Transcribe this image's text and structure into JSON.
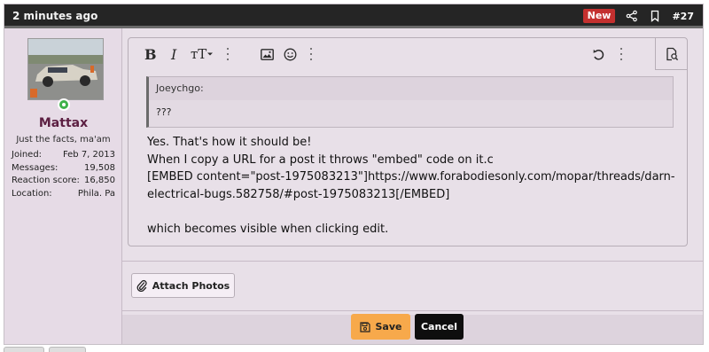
{
  "header": {
    "time": "2 minutes ago",
    "new_badge": "New",
    "post_number": "#27"
  },
  "user": {
    "name": "Mattax",
    "title": "Just the facts, ma'am",
    "stats": [
      {
        "label": "Joined:",
        "value": "Feb 7, 2013"
      },
      {
        "label": "Messages:",
        "value": "19,508"
      },
      {
        "label": "Reaction score:",
        "value": "16,850"
      },
      {
        "label": "Location:",
        "value": "Phila. Pa"
      }
    ]
  },
  "toolbar": {
    "bold": "B",
    "italic": "I",
    "text_size": "тT",
    "icons": [
      "bold-icon",
      "italic-icon",
      "text-size-icon",
      "more-icon",
      "image-icon",
      "smile-icon",
      "undo-icon",
      "preview-icon"
    ]
  },
  "quote": {
    "author": "Joeychgo:",
    "text": "???"
  },
  "message": {
    "line1": "Yes. That's how it should be!",
    "line2": "When I copy a URL for a post it throws \"embed\" code on it.c",
    "line3": "[EMBED content=\"post-1975083213\"]https://www.forabodiesonly.com/mopar/threads/darn-",
    "line4": "electrical-bugs.582758/#post-1975083213[/EMBED]",
    "line5": "which becomes visible when clicking edit."
  },
  "actions": {
    "attach_label": "Attach Photos",
    "save_label": "Save",
    "cancel_label": "Cancel"
  },
  "colors": {
    "header_bg": "#252525",
    "new_badge": "#c4302f",
    "username": "#5c1f42",
    "save": "#f7a94b",
    "cancel": "#0e0e0e",
    "online": "#3fb24a"
  }
}
